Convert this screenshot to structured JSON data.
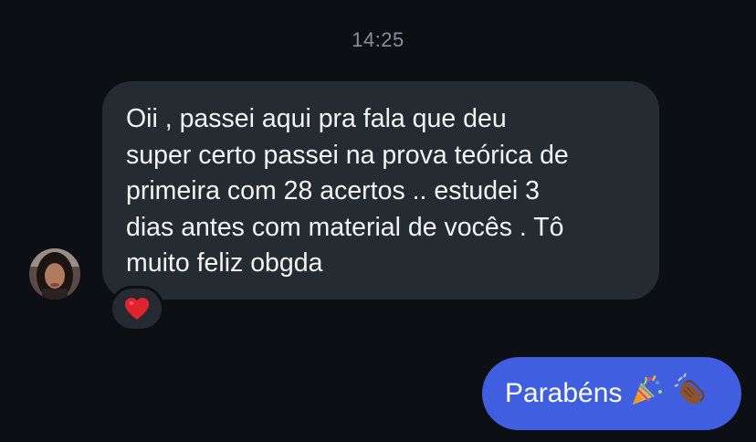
{
  "chat": {
    "timestamp": "14:25",
    "messages": [
      {
        "direction": "incoming",
        "text": "Oii , passei aqui pra fala que deu\nsuper certo passei na prova teórica de\nprimeira com 28 acertos .. estudei 3\ndias antes  com material de vocês . Tô\nmuito feliz obgda",
        "reaction": "heart-icon"
      },
      {
        "direction": "outgoing",
        "text": "Parabéns",
        "emojis": [
          "party-popper-icon",
          "clapping-hands-icon"
        ]
      }
    ]
  },
  "colors": {
    "background": "#0c0f14",
    "incoming_bubble": "#262a31",
    "outgoing_bubble": "#3f5fe0",
    "timestamp": "#8b8f96",
    "reaction_heart": "#e0242d"
  }
}
